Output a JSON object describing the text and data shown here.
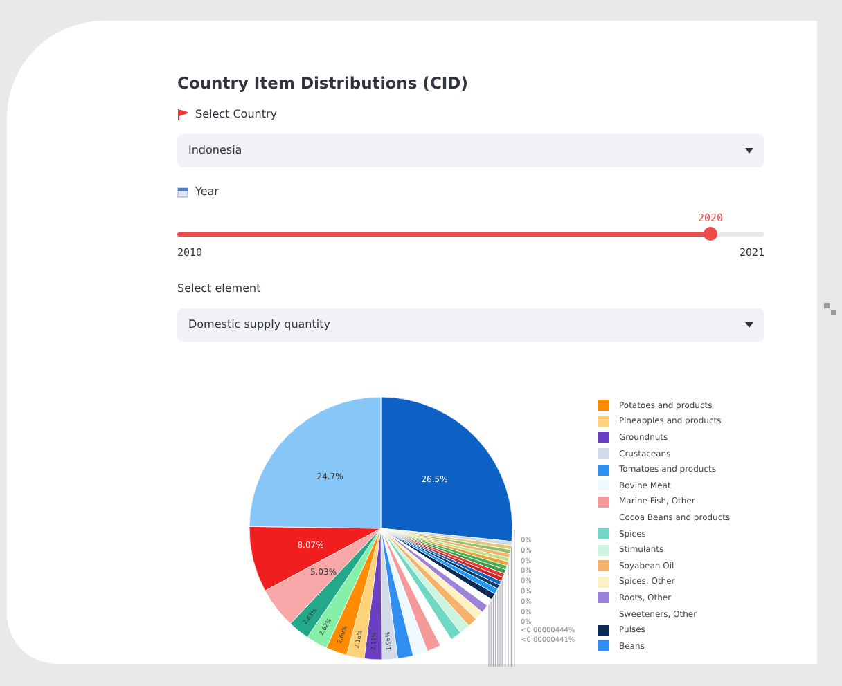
{
  "title": "Country Item Distributions (CID)",
  "country_select": {
    "label": "Select Country",
    "value": "Indonesia"
  },
  "year_slider": {
    "label": "Year",
    "value": "2020",
    "min": "2010",
    "max": "2021",
    "level": 0.908
  },
  "element_select": {
    "label": "Select element",
    "value": "Domestic supply quantity"
  },
  "chart": {
    "chart_data": {
      "type": "pie",
      "series": [
        {
          "values": [
            26.5,
            0.5,
            0.5,
            0.5,
            0.5,
            0.5,
            0.5,
            0.5,
            0.5,
            0.5,
            0.5,
            0.5,
            0.5,
            0.7,
            0.8,
            0.9,
            1.0,
            1.1,
            1.2,
            1.3,
            1.4,
            1.5,
            1.7,
            1.8,
            1.9,
            1.96,
            2.11,
            2.16,
            2.6,
            2.62,
            2.63,
            5.03,
            8.07,
            24.7
          ]
        }
      ],
      "colors": [
        "#0d60c4",
        "#cfd8e3",
        "#e3c77a",
        "#8fbf6a",
        "#f2b36b",
        "#c5e08a",
        "#e8a23a",
        "#4caf50",
        "#3f9e4a",
        "#e53935",
        "#c62828",
        "#1565c0",
        "#0b3d6b",
        "#2196f3",
        "#0a2a55",
        "#ffffff",
        "#9c82d9",
        "#fff2c2",
        "#f6b26b",
        "#cbf5e0",
        "#6ed8c4",
        "#ffffff",
        "#f59a9a",
        "#eef8ff",
        "#2f8ef0",
        "#d3dbe8",
        "#6a3fc2",
        "#ffd27a",
        "#ff8c00",
        "#86f0a8",
        "#23a889",
        "#f8a8a8",
        "#f01e1e",
        "#86c7f7"
      ],
      "value_labels": [
        "26.5%",
        null,
        null,
        null,
        null,
        null,
        null,
        null,
        null,
        null,
        null,
        null,
        null,
        null,
        null,
        null,
        null,
        null,
        null,
        null,
        null,
        null,
        null,
        null,
        null,
        "1.96%",
        "2.11%",
        "2.16%",
        "2.60%",
        "2.62%",
        "2.63%",
        "5.03%",
        "8.07%",
        "24.7%"
      ],
      "annotations": [
        {
          "text": "0%"
        },
        {
          "text": "0%"
        },
        {
          "text": "0%"
        },
        {
          "text": "0%"
        },
        {
          "text": "0%"
        },
        {
          "text": "0%"
        },
        {
          "text": "0%"
        },
        {
          "text": "0%"
        },
        {
          "text": "0%"
        },
        {
          "text": "<0.00000444%"
        },
        {
          "text": "<0.00000441%"
        }
      ]
    },
    "legend": [
      {
        "label": "Potatoes and products",
        "color": "#ff8c00"
      },
      {
        "label": "Pineapples and products",
        "color": "#ffd27a"
      },
      {
        "label": "Groundnuts",
        "color": "#6a3fc2"
      },
      {
        "label": "Crustaceans",
        "color": "#d3dbe8"
      },
      {
        "label": "Tomatoes and products",
        "color": "#2f8ef0"
      },
      {
        "label": "Bovine Meat",
        "color": "#eef8ff"
      },
      {
        "label": "Marine Fish, Other",
        "color": "#f59a9a"
      },
      {
        "label": "Cocoa Beans and products"
      },
      {
        "label": "Spices",
        "color": "#6ed8c4"
      },
      {
        "label": "Stimulants",
        "color": "#cbf5e0"
      },
      {
        "label": "Soyabean Oil",
        "color": "#f6b26b"
      },
      {
        "label": "Spices, Other",
        "color": "#fff2c2"
      },
      {
        "label": "Roots, Other",
        "color": "#9c82d9"
      },
      {
        "label": "Sweeteners, Other"
      },
      {
        "label": "Pulses",
        "color": "#0a2a55"
      },
      {
        "label": "Beans",
        "color": "#2f8ef0"
      }
    ]
  }
}
